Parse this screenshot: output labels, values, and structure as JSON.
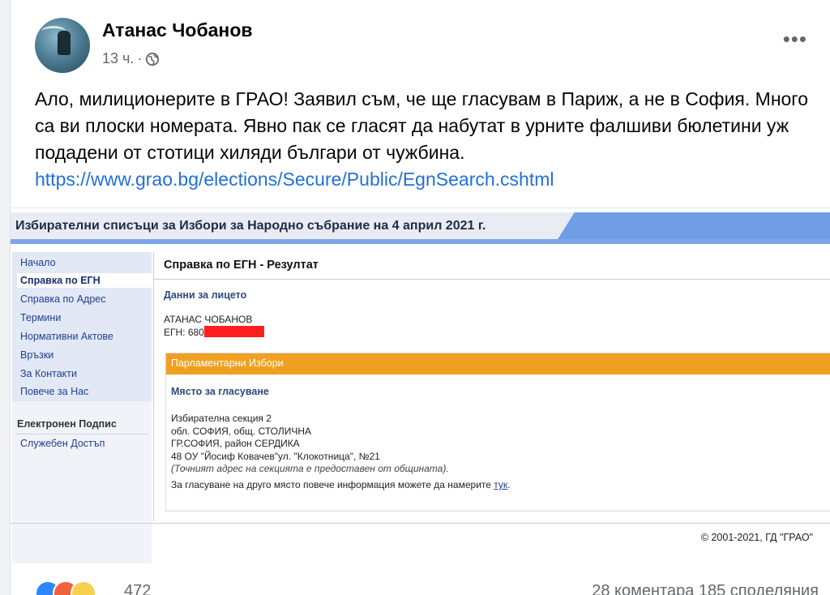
{
  "post": {
    "author": "Атанас Чобанов",
    "time": "13 ч.",
    "separator": "·",
    "privacy_icon": "globe-icon",
    "more_label": "•••",
    "text": "Ало, милиционерите в ГРАО! Заявил съм, че ще гласувам в Париж, а не в София. Много са ви плоски номерата. Явно пак се гласят да набутат в урните фалшиви бюлетини уж подадени от стотици хиляди българи от чужбина.",
    "link": "https://www.grao.bg/elections/Secure/Public/EgnSearch.cshtml"
  },
  "screenshot": {
    "header_title": "Избирателни списъци за Избори за Народно събрание на 4 април 2021 г.",
    "nav": {
      "items": [
        "Начало",
        "Справка по ЕГН",
        "Справка по Адрес",
        "Термини",
        "Нормативни Актове",
        "Връзки",
        "За Контакти",
        "Повече за Нас"
      ],
      "signature_heading": "Електронен Подпис",
      "service_access": "Служебен Достъп"
    },
    "result": {
      "title": "Справка по ЕГН - Резултат",
      "person_heading": "Данни за лицето",
      "name": "АТАНАС ЧОБАНОВ",
      "egn_label": "ЕГН: 680",
      "election_type": "Парламентарни Избори",
      "voting_place_heading": "Място за гласуване",
      "section": "Избирателна секция 2",
      "region": "обл. СОФИЯ, общ. СТОЛИЧНА",
      "city": "ГР.СОФИЯ, район СЕРДИКА",
      "school": "48 ОУ \"Йосиф Ковачев\"ул. \"Клокотница\", №21",
      "address_note": "(Точният адрес на секцията е предоставен от общината).",
      "other_place_text": "За гласуване на друго място повече информация можете да намерите",
      "here_link": "тук"
    },
    "footer": "© 2001-2021, ГД \"ГРАО\""
  },
  "engagement": {
    "reaction_icons": [
      "like-icon",
      "haha-icon",
      "wow-icon"
    ],
    "reaction_count": "472",
    "comments_shares": "28 коментара 185 споделяния"
  },
  "colors": {
    "link": "#216fdb",
    "orange_bar": "#f0a020",
    "header_blue": "#6f9ee6",
    "redaction": "#ff1f1f"
  }
}
